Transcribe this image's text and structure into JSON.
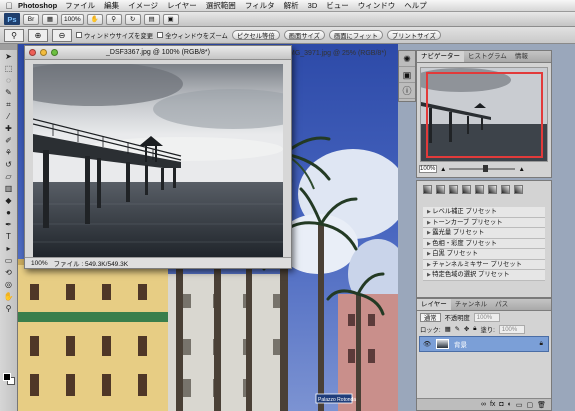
{
  "menubar": {
    "app": "Photoshop",
    "items": [
      "ファイル",
      "編集",
      "イメージ",
      "レイヤー",
      "選択範囲",
      "フィルタ",
      "解析",
      "3D",
      "ビュー",
      "ウィンドウ",
      "ヘルプ"
    ]
  },
  "appbar": {
    "logo": "Ps",
    "zoom": "100%"
  },
  "options": {
    "resize_label": "ウィンドウサイズを変更",
    "zoom_all_label": "全ウィンドウをズーム",
    "actual_pixels": "ピクセル等倍",
    "fit_screen": "画面サイズ",
    "fill_screen": "画面にフィット",
    "print_size": "プリントサイズ"
  },
  "bg_document": {
    "title": "MG_3971.jpg @ 25% (RGB/8*)"
  },
  "document": {
    "title": "_DSF3367.jpg @ 100% (RGB/8*)",
    "zoom": "100%",
    "file_info": "ファイル : 549.3K/549.3K"
  },
  "navigator": {
    "tabs": [
      "ナビゲーター",
      "ヒストグラム",
      "情報"
    ],
    "zoom": "100%"
  },
  "adjustments": {
    "presets": [
      "レベル補正 プリセット",
      "トーンカーブ プリセット",
      "露光量 プリセット",
      "色相・彩度 プリセット",
      "白黒 プリセット",
      "チャンネルミキサー プリセット",
      "特定色域の選択 プリセット"
    ]
  },
  "layers": {
    "tabs": [
      "レイヤー",
      "チャンネル",
      "パス"
    ],
    "blend_mode": "通常",
    "opacity_label": "不透明度",
    "opacity": "100%",
    "lock_label": "ロック:",
    "fill_label": "塗り:",
    "fill": "100%",
    "layer_name": "背景"
  },
  "street_sign": "Palazzo Rotonda",
  "colors": {
    "panel": "#d3d3d3",
    "selection": "#7b9fd7",
    "nav_box": "#e23a3a"
  }
}
